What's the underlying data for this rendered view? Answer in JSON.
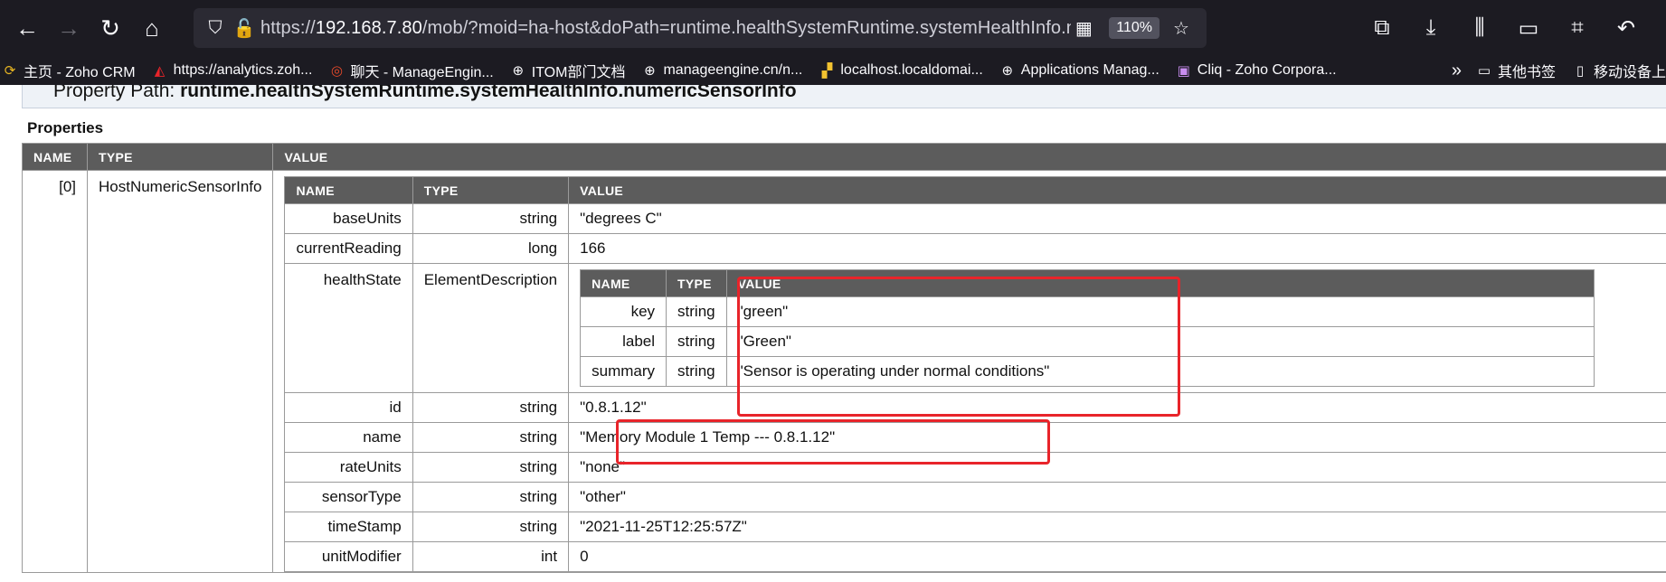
{
  "browser": {
    "url_prefix": "https://",
    "url_host": "192.168.7.80",
    "url_rest": "/mob/?moid=ha-host&doPath=runtime.healthSystemRuntime.systemHealthInfo.numericSensorInfo",
    "zoom": "110%"
  },
  "bookmarks": [
    {
      "label": "主页 - Zoho CRM",
      "icon": "zoho-icon"
    },
    {
      "label": "https://analytics.zoh...",
      "icon": "analytics-icon"
    },
    {
      "label": "聊天 - ManageEngin...",
      "icon": "chat-icon"
    },
    {
      "label": "ITOM部门文档",
      "icon": "globe-icon"
    },
    {
      "label": "manageengine.cn/n...",
      "icon": "globe-icon"
    },
    {
      "label": "localhost.localdomai...",
      "icon": "vmware-icon"
    },
    {
      "label": "Applications Manag...",
      "icon": "globe-icon"
    },
    {
      "label": "Cliq - Zoho Corpora...",
      "icon": "cliq-icon"
    }
  ],
  "bookmarks_right": {
    "folder": "其他书签",
    "mobile": "移动设备上"
  },
  "page": {
    "property_path_label": "Property Path:",
    "property_path_value": "runtime.healthSystemRuntime.systemHealthInfo.numericSensorInfo",
    "properties_title": "Properties"
  },
  "outer_headers": [
    "NAME",
    "TYPE",
    "VALUE"
  ],
  "outer_row": {
    "name": "[0]",
    "type": "HostNumericSensorInfo"
  },
  "inner_headers": [
    "NAME",
    "TYPE",
    "VALUE"
  ],
  "inner_rows": [
    {
      "name": "baseUnits",
      "type": "string",
      "value": "\"degrees C\""
    },
    {
      "name": "currentReading",
      "type": "long",
      "value": "166"
    },
    {
      "name": "healthState",
      "type": "ElementDescription",
      "value": ""
    },
    {
      "name": "id",
      "type": "string",
      "value": "\"0.8.1.12\""
    },
    {
      "name": "name",
      "type": "string",
      "value": "\"Memory Module 1 Temp --- 0.8.1.12\""
    },
    {
      "name": "rateUnits",
      "type": "string",
      "value": "\"none\""
    },
    {
      "name": "sensorType",
      "type": "string",
      "value": "\"other\""
    },
    {
      "name": "timeStamp",
      "type": "string",
      "value": "\"2021-11-25T12:25:57Z\""
    },
    {
      "name": "unitModifier",
      "type": "int",
      "value": "0"
    }
  ],
  "nested_headers": [
    "NAME",
    "TYPE",
    "VALUE"
  ],
  "nested_rows": [
    {
      "name": "key",
      "type": "string",
      "value": "\"green\""
    },
    {
      "name": "label",
      "type": "string",
      "value": "\"Green\""
    },
    {
      "name": "summary",
      "type": "string",
      "value": "\"Sensor is operating under normal conditions\""
    }
  ]
}
